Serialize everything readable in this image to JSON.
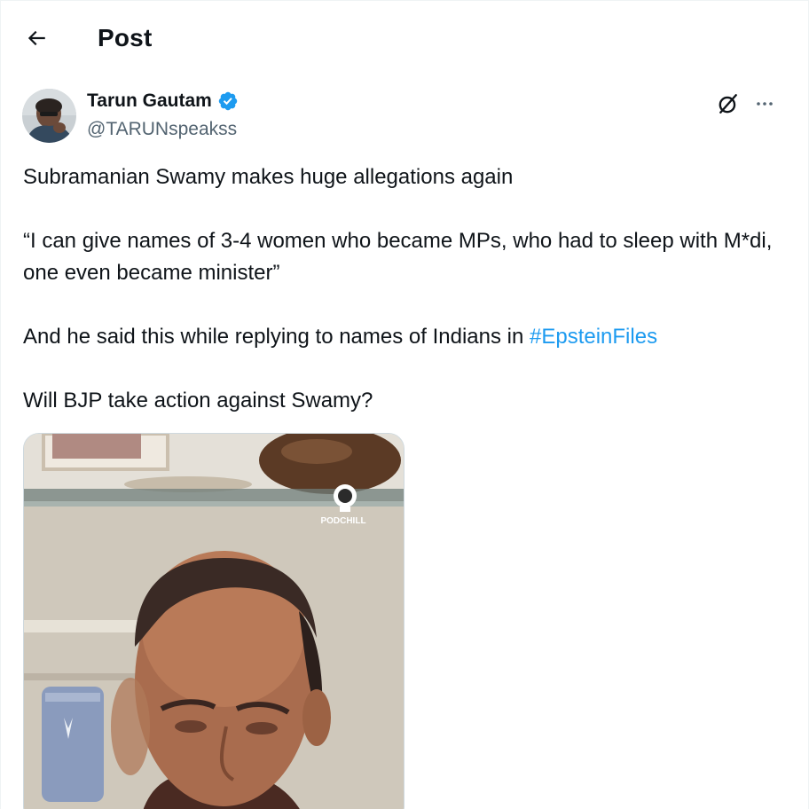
{
  "header": {
    "title": "Post",
    "back_icon": "arrow-left-icon"
  },
  "author": {
    "name": "Tarun Gautam",
    "handle": "@TARUNspeakss",
    "verified": true,
    "verified_color": "#1d9bf0"
  },
  "actions": {
    "grok_icon": "grok-icon",
    "more_icon": "more-horizontal-icon"
  },
  "tweet": {
    "line1": "Subramanian Swamy makes huge allegations again",
    "quote": "“I can give names of 3-4 women who became MPs, who had to sleep with M*di, one even became minister”",
    "line3_prefix": "And he said this while replying to names of Indians in ",
    "hashtag": "#EpsteinFiles",
    "line4": "Will BJP take action against Swamy?"
  },
  "media": {
    "watermark": "PODCHILL"
  },
  "colors": {
    "link": "#1d9bf0",
    "secondary_text": "#536471",
    "primary_text": "#0f1419"
  }
}
